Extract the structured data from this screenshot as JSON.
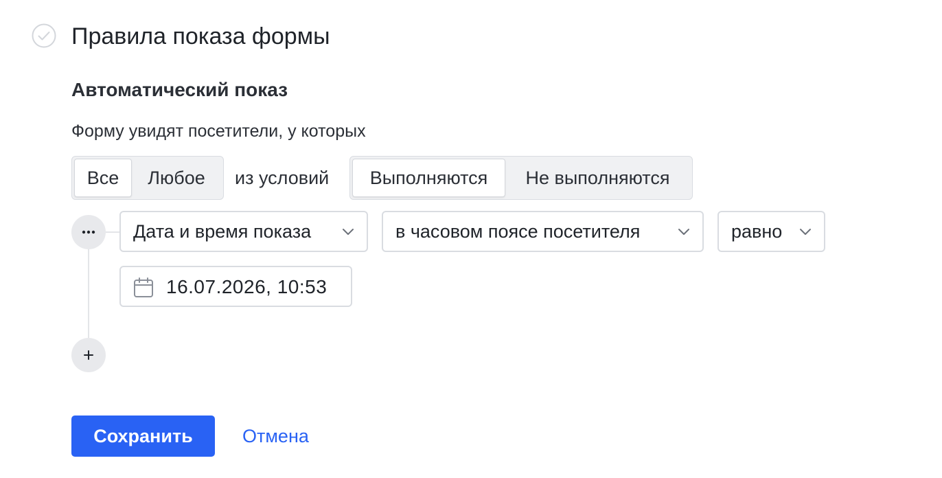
{
  "header": {
    "title": "Правила показа формы",
    "status_icon": "check-circle-icon"
  },
  "auto_show": {
    "title": "Автоматический показ",
    "description": "Форму увидят посетители, у которых"
  },
  "match_mode": {
    "options": [
      "Все",
      "Любое"
    ],
    "selected": "Все"
  },
  "between_label": "из условий",
  "condition_mode": {
    "options": [
      "Выполняются",
      "Не выполняются"
    ],
    "selected": "Выполняются"
  },
  "condition": {
    "more_icon": "ellipsis-icon",
    "field": "Дата и время показа",
    "timezone": "в часовом поясе посетителя",
    "operator": "равно",
    "date_value": "16.07.2026, 10:53",
    "date_icon": "calendar-icon"
  },
  "add_condition_icon": "plus-icon",
  "actions": {
    "save_label": "Сохранить",
    "cancel_label": "Отмена"
  },
  "colors": {
    "accent": "#2962f4",
    "border": "#d9dce1",
    "segment_bg": "#f0f1f3"
  }
}
